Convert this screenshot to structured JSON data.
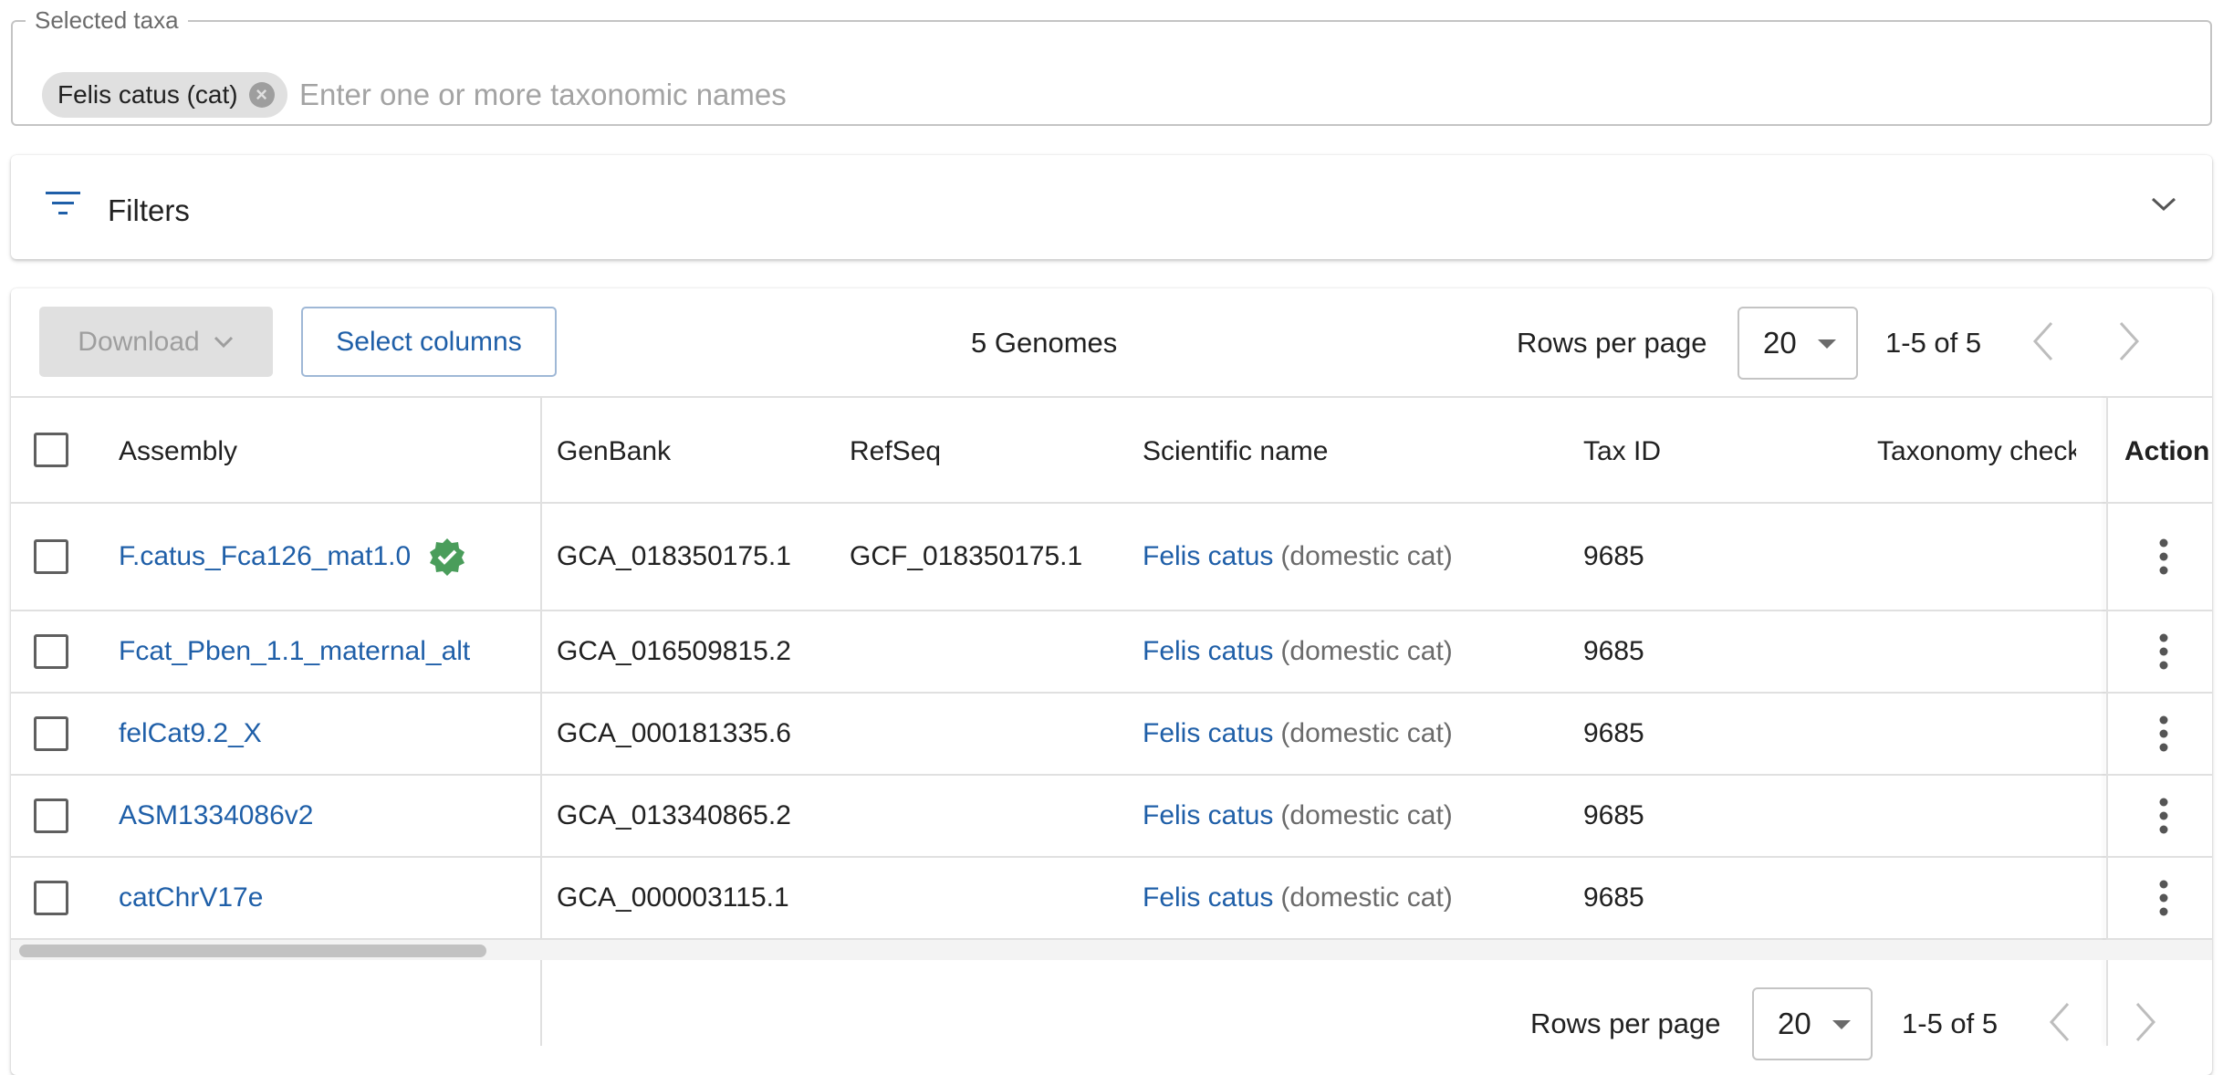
{
  "taxa": {
    "legend": "Selected taxa",
    "chip_label": "Felis catus (cat)",
    "input_placeholder": "Enter one or more taxonomic names",
    "input_value": ""
  },
  "filters": {
    "label": "Filters"
  },
  "toolbar": {
    "download_label": "Download",
    "select_columns_label": "Select columns",
    "genome_count": "5 Genomes",
    "rows_per_page_label": "Rows per page",
    "rows_per_page_value": "20",
    "page_range": "1-5 of 5"
  },
  "table": {
    "headers": {
      "assembly": "Assembly",
      "genbank": "GenBank",
      "refseq": "RefSeq",
      "scientific_name": "Scientific name",
      "tax_id": "Tax ID",
      "taxonomy_check": "Taxonomy check",
      "action": "Action"
    },
    "rows": [
      {
        "assembly": "F.catus_Fca126_mat1.0",
        "genbank": "GCA_018350175.1",
        "refseq": "GCF_018350175.1",
        "sci_name": "Felis catus",
        "common": "(domestic cat)",
        "tax_id": "9685",
        "verified": true
      },
      {
        "assembly": "Fcat_Pben_1.1_maternal_alt",
        "genbank": "GCA_016509815.2",
        "refseq": "",
        "sci_name": "Felis catus",
        "common": "(domestic cat)",
        "tax_id": "9685",
        "verified": false
      },
      {
        "assembly": "felCat9.2_X",
        "genbank": "GCA_000181335.6",
        "refseq": "",
        "sci_name": "Felis catus",
        "common": "(domestic cat)",
        "tax_id": "9685",
        "verified": false
      },
      {
        "assembly": "ASM1334086v2",
        "genbank": "GCA_013340865.2",
        "refseq": "",
        "sci_name": "Felis catus",
        "common": "(domestic cat)",
        "tax_id": "9685",
        "verified": false
      },
      {
        "assembly": "catChrV17e",
        "genbank": "GCA_000003115.1",
        "refseq": "",
        "sci_name": "Felis catus",
        "common": "(domestic cat)",
        "tax_id": "9685",
        "verified": false
      }
    ]
  },
  "footer": {
    "rows_per_page_label": "Rows per page",
    "rows_per_page_value": "20",
    "page_range": "1-5 of 5"
  },
  "colors": {
    "link": "#1f5fa8",
    "verified_badge": "#4a9d5b",
    "chip_bg": "#e0e0e0"
  },
  "icons": {
    "filters": "filter-lines-icon",
    "expand": "chevron-down-icon",
    "chip_remove": "cancel-circle-icon",
    "verified": "verified-badge-icon",
    "row_action": "kebab-menu-icon",
    "prev": "chevron-left-icon",
    "next": "chevron-right-icon"
  }
}
